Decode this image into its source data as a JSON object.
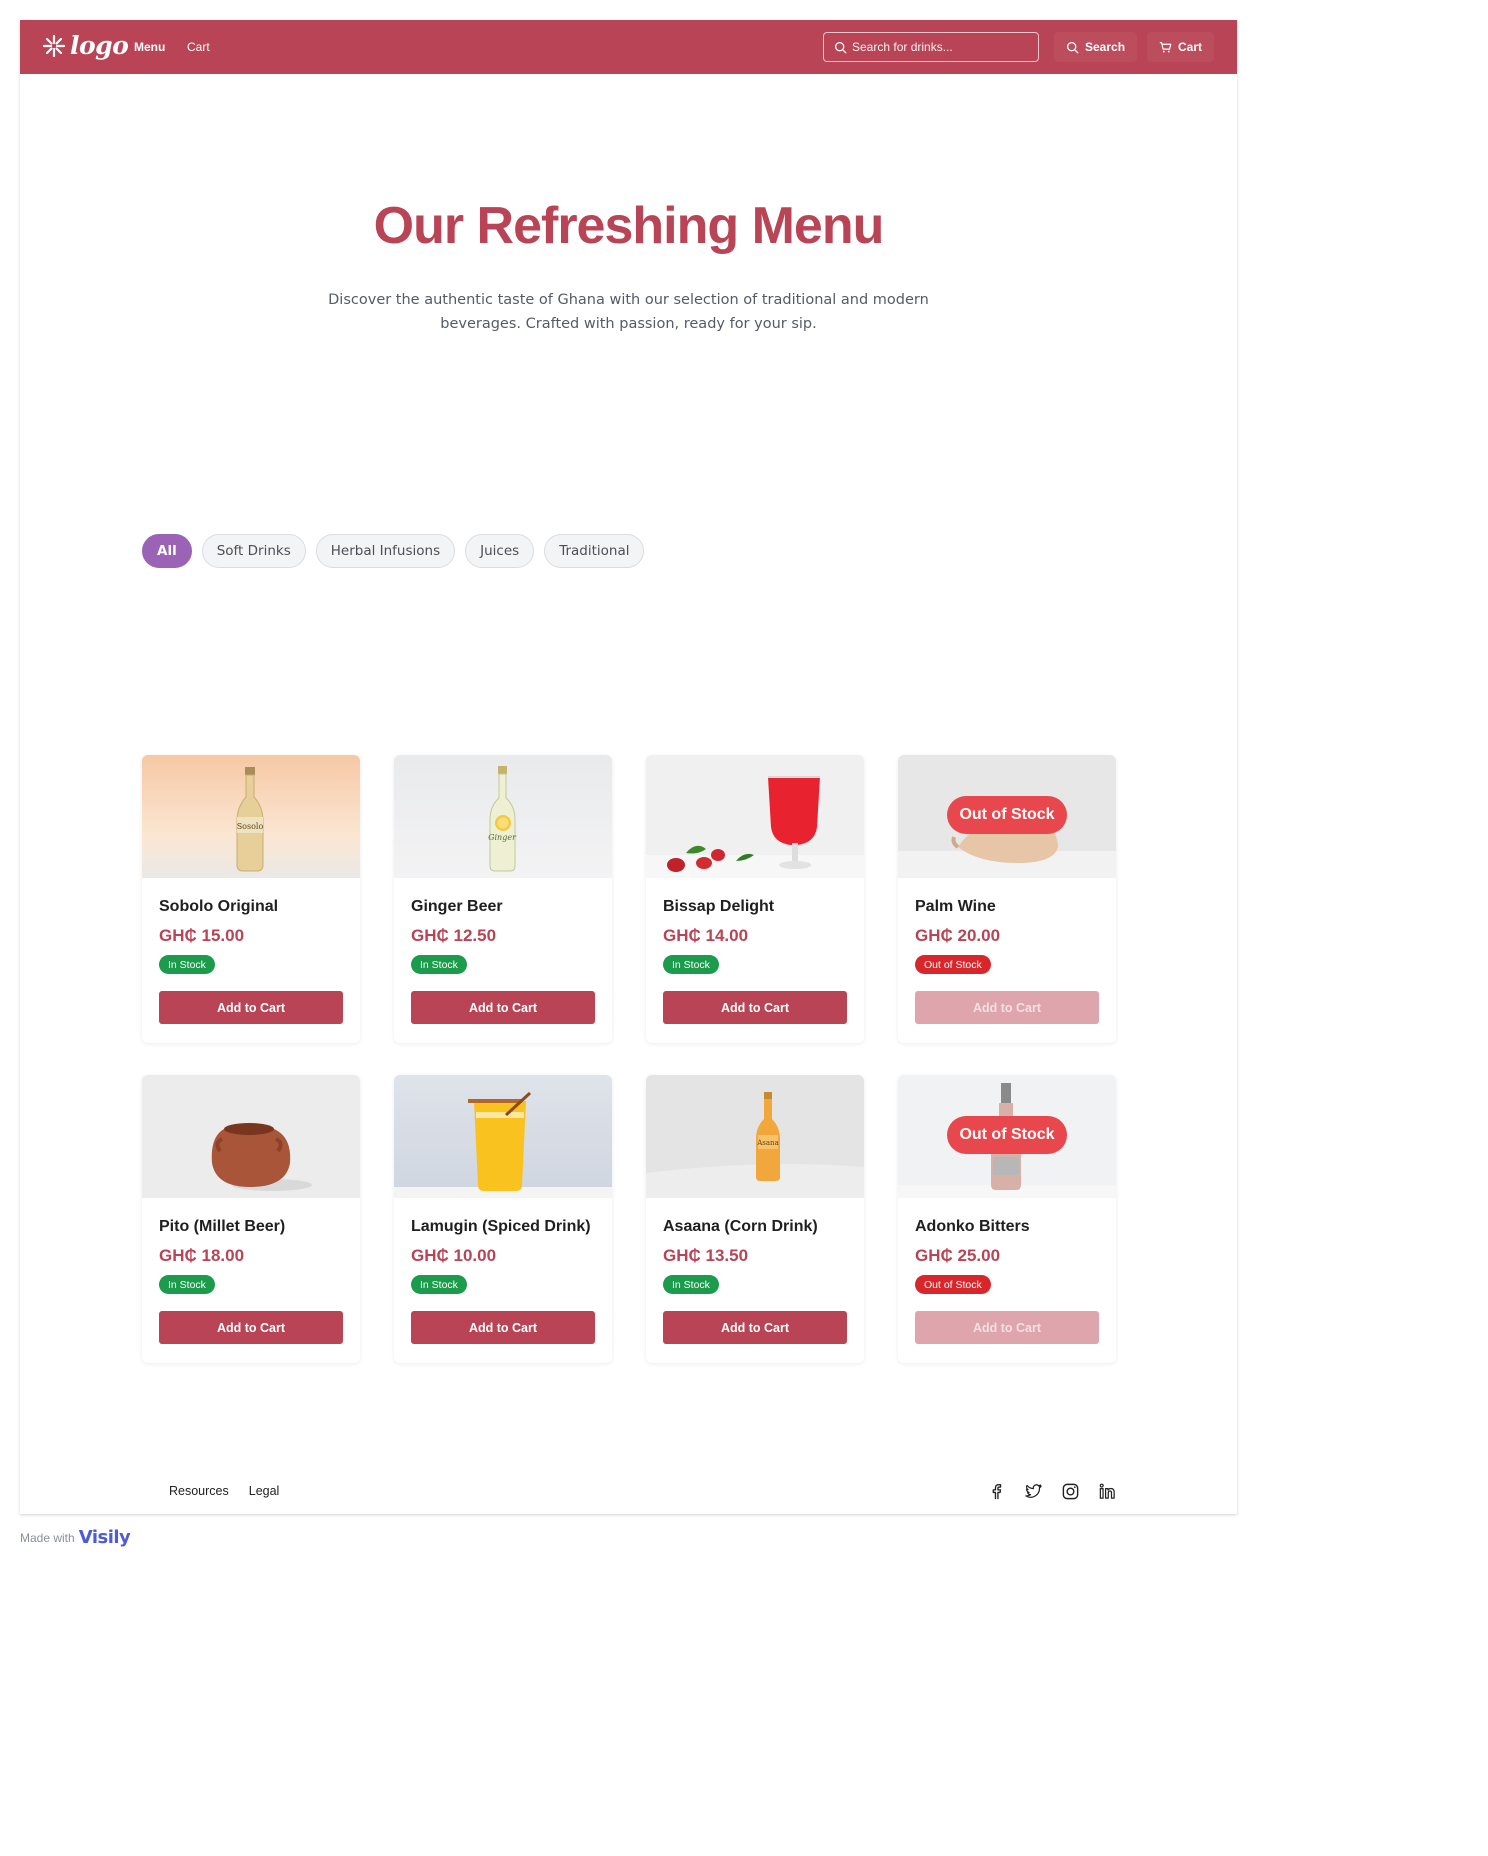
{
  "header": {
    "logo_text": "logo",
    "nav": [
      {
        "label": "Menu"
      },
      {
        "label": "Cart"
      }
    ],
    "search_placeholder": "Search for drinks...",
    "search_button_label": "Search",
    "cart_button_label": "Cart",
    "brand_color": "#b84455"
  },
  "hero": {
    "title": "Our Refreshing Menu",
    "subtitle": "Discover the authentic taste of Ghana with our selection of traditional and modern beverages. Crafted with passion, ready for your sip."
  },
  "filters": [
    {
      "label": "All",
      "active": true
    },
    {
      "label": "Soft Drinks",
      "active": false
    },
    {
      "label": "Herbal Infusions",
      "active": false
    },
    {
      "label": "Juices",
      "active": false
    },
    {
      "label": "Traditional",
      "active": false
    }
  ],
  "products": [
    {
      "name": "Sobolo Original",
      "price": "GH₵ 15.00",
      "status": "In Stock",
      "in_stock": true,
      "button": "Add to Cart",
      "image_icon": "bottle-sobolo-icon",
      "bottle_label": "Sosolo"
    },
    {
      "name": "Ginger Beer",
      "price": "GH₵ 12.50",
      "status": "In Stock",
      "in_stock": true,
      "button": "Add to Cart",
      "image_icon": "bottle-ginger-icon",
      "bottle_label": "Ginger"
    },
    {
      "name": "Bissap Delight",
      "price": "GH₵ 14.00",
      "status": "In Stock",
      "in_stock": true,
      "button": "Add to Cart",
      "image_icon": "glass-bissap-icon"
    },
    {
      "name": "Palm Wine",
      "price": "GH₵ 20.00",
      "status": "Out of Stock",
      "in_stock": false,
      "button": "Add to Cart",
      "image_icon": "gourd-palm-wine-icon",
      "overlay": "Out of Stock"
    },
    {
      "name": "Pito (Millet Beer)",
      "price": "GH₵ 18.00",
      "status": "In Stock",
      "in_stock": true,
      "button": "Add to Cart",
      "image_icon": "clay-pot-icon"
    },
    {
      "name": "Lamugin (Spiced Drink)",
      "price": "GH₵ 10.00",
      "status": "In Stock",
      "in_stock": true,
      "button": "Add to Cart",
      "image_icon": "glass-lamugin-icon"
    },
    {
      "name": "Asaana (Corn Drink)",
      "price": "GH₵ 13.50",
      "status": "In Stock",
      "in_stock": true,
      "button": "Add to Cart",
      "image_icon": "bottle-asaana-icon",
      "bottle_label": "Asana"
    },
    {
      "name": "Adonko Bitters",
      "price": "GH₵ 25.00",
      "status": "Out of Stock",
      "in_stock": false,
      "button": "Add to Cart",
      "image_icon": "bottle-bitters-icon",
      "overlay": "Out of Stock"
    }
  ],
  "footer": {
    "links": [
      {
        "label": "Resources"
      },
      {
        "label": "Legal"
      }
    ],
    "socials": [
      "facebook-icon",
      "twitter-icon",
      "instagram-icon",
      "linkedin-icon"
    ]
  },
  "made_with": {
    "label": "Made with",
    "brand": "Visily"
  }
}
